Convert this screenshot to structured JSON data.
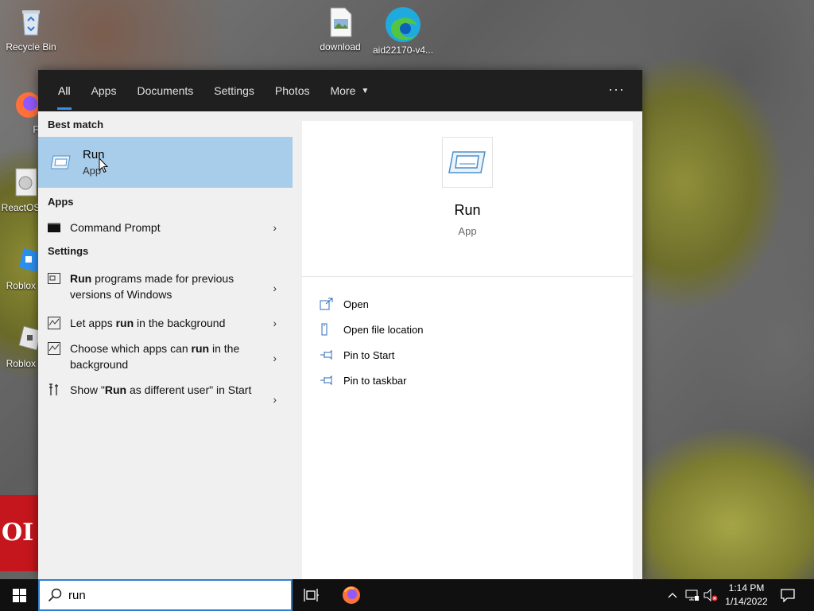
{
  "desktop": {
    "icons": [
      {
        "label": "Recycle Bin"
      },
      {
        "label": "Firefo"
      },
      {
        "label": "ReactOS"
      },
      {
        "label": "Roblox S"
      },
      {
        "label": "Roblox P"
      },
      {
        "label": "download"
      },
      {
        "label": "aid22170-v4..."
      }
    ],
    "red_block_text": "OI"
  },
  "search": {
    "tabs": [
      {
        "label": "All",
        "active": true
      },
      {
        "label": "Apps"
      },
      {
        "label": "Documents"
      },
      {
        "label": "Settings"
      },
      {
        "label": "Photos"
      },
      {
        "label": "More"
      }
    ],
    "more_options": "···",
    "best_match_title": "Best match",
    "best_match": {
      "title": "Run",
      "subtitle": "App"
    },
    "apps_title": "Apps",
    "apps": [
      {
        "label": "Command Prompt"
      }
    ],
    "settings_title": "Settings",
    "settings": [
      {
        "pre": "",
        "bold": "Run",
        "post": " programs made for previous versions of Windows"
      },
      {
        "pre": "Let apps ",
        "bold": "run",
        "post": " in the background"
      },
      {
        "pre": "Choose which apps can ",
        "bold": "run",
        "post": " in the background"
      },
      {
        "pre": "Show \"",
        "bold": "Run",
        "post": " as different user\" in Start"
      }
    ],
    "detail": {
      "title": "Run",
      "subtitle": "App",
      "actions": [
        {
          "label": "Open"
        },
        {
          "label": "Open file location"
        },
        {
          "label": "Pin to Start"
        },
        {
          "label": "Pin to taskbar"
        }
      ]
    },
    "query": "run"
  },
  "taskbar": {
    "time": "1:14 PM",
    "date": "1/14/2022"
  },
  "colors": {
    "selection": "#a8cdeb",
    "accent": "#3a8ee6",
    "taskbar": "#101010"
  }
}
